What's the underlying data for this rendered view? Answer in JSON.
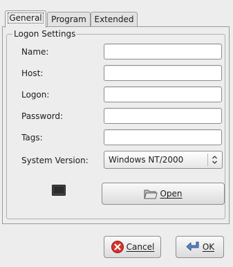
{
  "tabs": [
    {
      "label": "General",
      "active": true
    },
    {
      "label": "Program",
      "active": false
    },
    {
      "label": "Extended",
      "active": false
    }
  ],
  "logon_settings": {
    "title": "Logon Settings",
    "fields": [
      {
        "label": "Name:",
        "value": ""
      },
      {
        "label": "Host:",
        "value": ""
      },
      {
        "label": "Logon:",
        "value": ""
      },
      {
        "label": "Password:",
        "value": ""
      },
      {
        "label": "Tags:",
        "value": ""
      }
    ],
    "system_version": {
      "label": "System Version:",
      "selected": "Windows NT/2000"
    },
    "open_button": {
      "label": "Open",
      "icon": "folder-open-icon"
    },
    "small_icon": "terminal-icon"
  },
  "dialog_buttons": {
    "cancel": {
      "label": "Cancel",
      "icon": "cancel-icon"
    },
    "ok": {
      "label": "OK",
      "icon": "ok-arrow-icon"
    }
  }
}
